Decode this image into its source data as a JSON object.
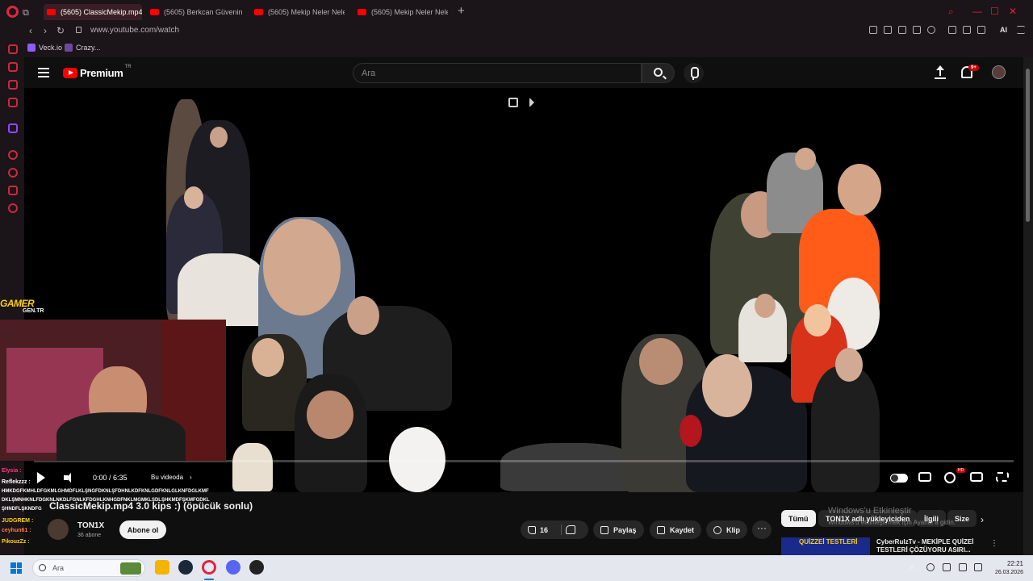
{
  "browser": {
    "tabs": [
      {
        "label": "(5605) ClassicMekip.mp4",
        "active": true
      },
      {
        "label": "(5605) Berkcan Güvenin Y",
        "active": false
      },
      {
        "label": "(5605) Mekip Neler Neler",
        "active": false
      },
      {
        "label": "(5605) Mekip Neler Neler",
        "active": false
      }
    ],
    "url": "www.youtube.com/watch",
    "ai_label": "AI",
    "bookmarks": [
      {
        "label": "Veck.io"
      },
      {
        "label": "Crazy..."
      }
    ],
    "accent_color": "#e0253f"
  },
  "youtube": {
    "brand": "Premium",
    "region": "TR",
    "search_placeholder": "Ara",
    "notification_badge": "9+"
  },
  "player": {
    "time": "0:00 / 6:35",
    "chapter": "Bu videoda",
    "progress_fraction": 0.0,
    "hd_badge": "HD"
  },
  "overlay": {
    "logo_main": "GAMER",
    "logo_sub": "GEN.TR",
    "chat": [
      {
        "user": "Elysia :",
        "text": "",
        "color": "#ff3b7a"
      },
      {
        "user": "Reflekzzz :",
        "text": "",
        "color": "#ffffff"
      },
      {
        "user": "",
        "text": "HMKDGFKMHLDFGKMLGHMDFLKLŞNGFDKNLŞFDHNLKDFKNLGDFKNLGLKNFDGLKMF",
        "color": "#ffffff"
      },
      {
        "user": "",
        "text": "DKLŞMNHKNLFDGKNLNKDLFGNLKFDGHLKNHGDFNKLMGMKLŞDLŞHKMDFŞKMFGDKL",
        "color": "#ffffff"
      },
      {
        "user": "",
        "text": "ŞHNDFLŞKNDFG",
        "color": "#ffffff"
      },
      {
        "user": "JUDGREM :",
        "text": "",
        "color": "#ffd200"
      },
      {
        "user": "ceyhun61 :",
        "text": "",
        "color": "#ff7a3b"
      },
      {
        "user": "PikouzZz :",
        "text": "",
        "color": "#ffd200"
      }
    ]
  },
  "video": {
    "title": "ClassicMekip.mp4 3.0 kips :) (öpücük sonlu)",
    "channel": "TON1X",
    "subscribers": "36 abone",
    "subscribe_label": "Abone ol",
    "likes": "16",
    "share_label": "Paylaş",
    "save_label": "Kaydet",
    "clip_label": "Klip",
    "more_label": "···"
  },
  "sidebar": {
    "chips": [
      {
        "label": "Tümü",
        "selected": true
      },
      {
        "label": "TON1X adlı yükleyiciden",
        "selected": false
      },
      {
        "label": "İlgili",
        "selected": false
      },
      {
        "label": "Size",
        "selected": false
      }
    ],
    "recommended": [
      {
        "thumb_text": "QUİZZEİ TESTLERİ",
        "title": "CyberRulzTv - MEKİPLE QUİZEİ TESTLERİ ÇÖZÜYORU ASIRI..."
      }
    ]
  },
  "watermark": {
    "title": "Windows'u Etkinleştir",
    "subtitle": "Windows'u etkinleştirmek için Ayarlar'a gidin."
  },
  "taskbar": {
    "search_placeholder": "Ara",
    "time": "22:21",
    "date": "26.03.2026"
  }
}
